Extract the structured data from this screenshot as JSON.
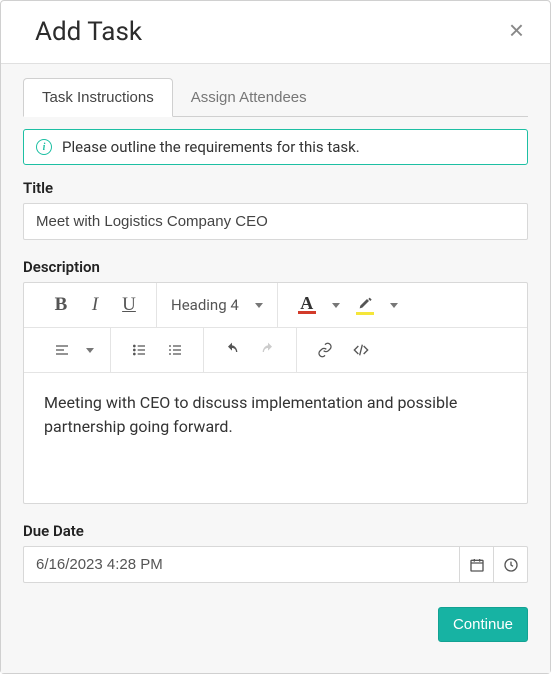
{
  "header": {
    "title": "Add Task",
    "close_glyph": "×"
  },
  "tabs": {
    "instructions": "Task Instructions",
    "attendees": "Assign Attendees"
  },
  "banner": {
    "text": "Please outline the requirements for this task."
  },
  "fields": {
    "title_label": "Title",
    "title_value": "Meet with Logistics Company CEO",
    "description_label": "Description",
    "description_value": "Meeting with CEO to discuss implementation and possible partnership going forward.",
    "due_label": "Due Date",
    "due_value": "6/16/2023 4:28 PM"
  },
  "toolbar": {
    "heading_label": "Heading 4",
    "text_color": "#d23b2a",
    "highlight_color": "#f5e63a"
  },
  "footer": {
    "continue_label": "Continue"
  }
}
